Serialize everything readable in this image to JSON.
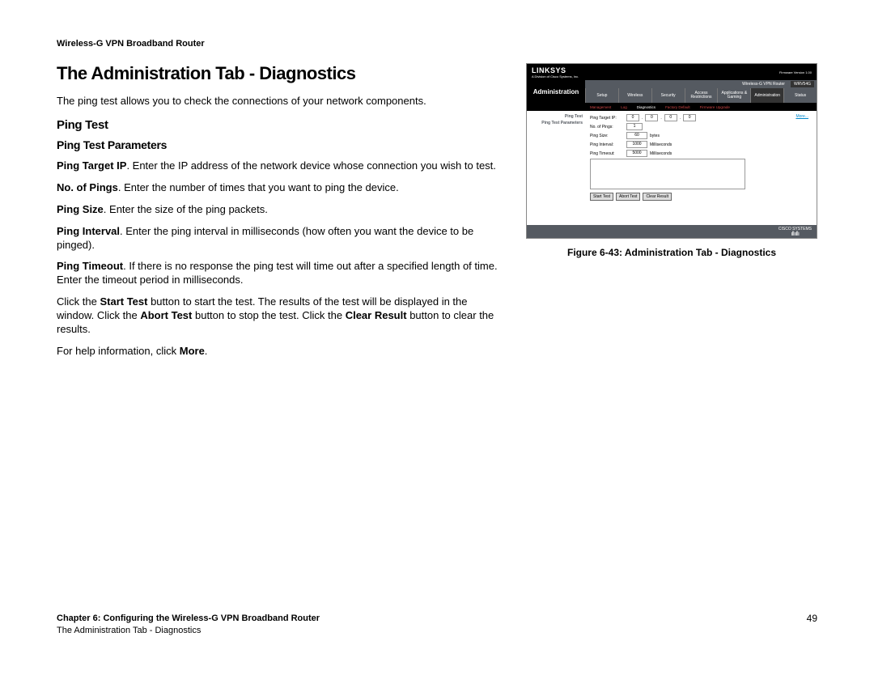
{
  "header": "Wireless-G VPN Broadband Router",
  "title": "The Administration Tab - Diagnostics",
  "intro": "The ping test allows you to check the connections of your network components.",
  "h2": "Ping Test",
  "h3": "Ping Test Parameters",
  "p_target_b": "Ping Target IP",
  "p_target": ". Enter the IP address of the network device whose connection you wish to test.",
  "p_pings_b": "No. of Pings",
  "p_pings": ". Enter the number of times that you want to ping the device.",
  "p_size_b": "Ping Size",
  "p_size": ". Enter the size of the ping packets.",
  "p_interval_b": "Ping Interval",
  "p_interval": ". Enter the ping interval in milliseconds (how often you want the device to be pinged).",
  "p_timeout_b": "Ping Timeout",
  "p_timeout": ". If there is no response the ping test will time out after a specified length of time. Enter the timeout period in milliseconds.",
  "p_click_1": "Click the ",
  "p_click_b1": "Start Test",
  "p_click_2": " button to start the test. The results of the test will be displayed in the window. Click the ",
  "p_click_b2": "Abort Test",
  "p_click_3": " button to stop the test. Click the ",
  "p_click_b3": "Clear Result",
  "p_click_4": " button to clear the results.",
  "p_help_1": "For help information, click ",
  "p_help_b": "More",
  "p_help_2": ".",
  "figure_caption": "Figure 6-43: Administration Tab - Diagnostics",
  "footer_line1": "Chapter 6: Configuring the Wireless-G VPN Broadband Router",
  "footer_line2": "The Administration Tab - Diagnostics",
  "page_number": "49",
  "thumb": {
    "brand": "LINKSYS",
    "brand_sub": "A Division of Cisco Systems, Inc.",
    "firmware": "Firmware Version 1.00",
    "model_label": "Wireless-G VPN Router",
    "model": "WRV54G",
    "section": "Administration",
    "tabs": [
      "Setup",
      "Wireless",
      "Security",
      "Access Restrictions",
      "Applications & Gaming",
      "Administration",
      "Status"
    ],
    "subtabs": [
      "Management",
      "Log",
      "Diagnostics",
      "Factory Default",
      "Firmware Upgrade"
    ],
    "side1": "Ping Test",
    "side2": "Ping Test Parameters",
    "more": "More...",
    "rows": {
      "target": "Ping Target IP:",
      "pings": "No. of Pings:",
      "pings_val": "1",
      "size": "Ping Size:",
      "size_val": "60",
      "size_unit": "bytes",
      "interval": "Ping Interval:",
      "interval_val": "1000",
      "interval_unit": "Milliseconds",
      "timeout": "Ping Timeout:",
      "timeout_val": "5000",
      "timeout_unit": "Milliseconds"
    },
    "btns": {
      "start": "Start Test",
      "abort": "Abort Test",
      "clear": "Clear Result"
    },
    "cisco": "CISCO SYSTEMS"
  }
}
